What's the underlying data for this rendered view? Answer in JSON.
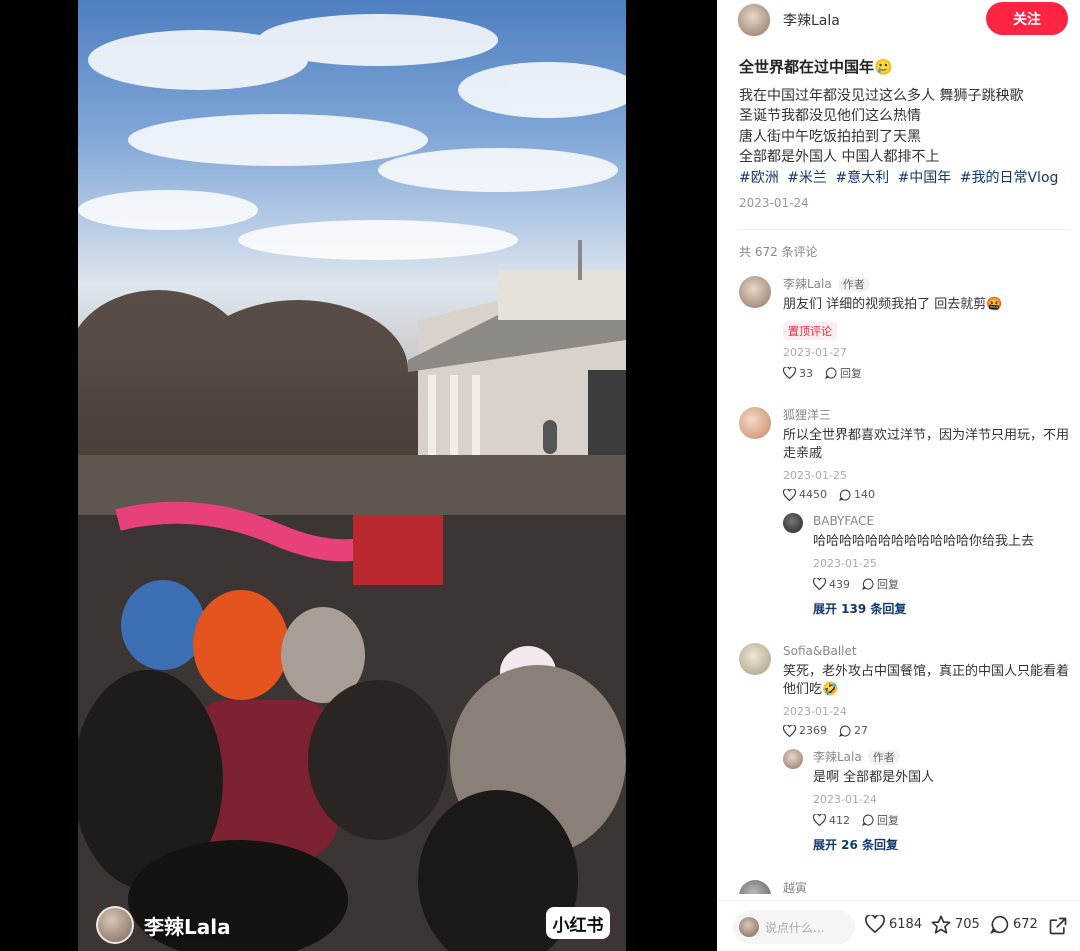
{
  "video": {
    "author": "李辣Lala",
    "logo": "小红书"
  },
  "header": {
    "author_name": "李辣Lala",
    "follow_label": "关注"
  },
  "note": {
    "title": "全世界都在过中国年🥲",
    "lines": [
      "我在中国过年都没见过这么多人 舞狮子跳秧歌",
      "圣诞节我都没见他们这么热情",
      "唐人街中午吃饭拍拍到了天黑",
      "全部都是外国人 中国人都排不上"
    ],
    "tags": [
      "#欧洲",
      "#米兰",
      "#意大利",
      "#中国年",
      "#我的日常Vlog"
    ],
    "date": "2023-01-24"
  },
  "comments_header": "共 672 条评论",
  "comments": [
    {
      "name": "李辣Lala",
      "badge": "作者",
      "text": "朋友们 详细的视频我拍了 回去就剪🤬",
      "pin": "置顶评论",
      "date": "2023-01-27",
      "likes": "33",
      "reply_label": "回复"
    },
    {
      "name": "狐狸洋三",
      "text": "所以全世界都喜欢过洋节，因为洋节只用玩，不用走亲戚",
      "date": "2023-01-25",
      "likes": "4450",
      "replies": "140",
      "sub": {
        "name": "BABYFACE",
        "text": "哈哈哈哈哈哈哈哈哈哈哈哈你给我上去",
        "date": "2023-01-25",
        "likes": "439",
        "reply_label": "回复"
      },
      "expand": "展开 139 条回复"
    },
    {
      "name": "Sofia&Ballet",
      "text": "笑死，老外攻占中国餐馆，真正的中国人只能看着他们吃🤣",
      "date": "2023-01-24",
      "likes": "2369",
      "replies": "27",
      "sub": {
        "name": "李辣Lala",
        "badge": "作者",
        "text": "是啊 全部都是外国人",
        "date": "2023-01-24",
        "likes": "412",
        "reply_label": "回复"
      },
      "expand": "展开 26 条回复"
    },
    {
      "name": "越寅"
    }
  ],
  "bottom": {
    "input_placeholder": "说点什么...",
    "likes": "6184",
    "stars": "705",
    "comments": "672"
  },
  "colors": {
    "accent": "#ff2442",
    "link": "#13386c"
  }
}
